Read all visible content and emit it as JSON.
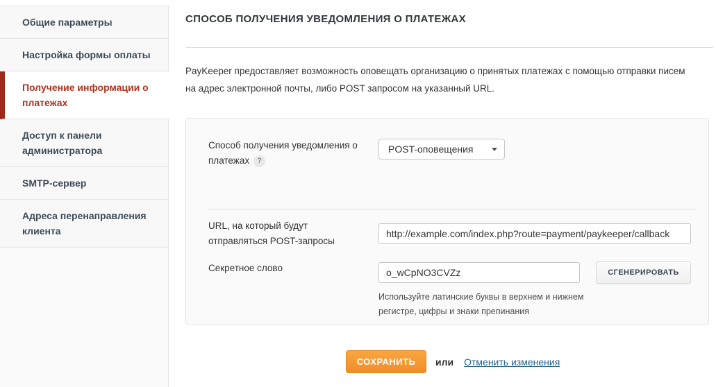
{
  "theme": {
    "save_button_orange": "#f49a33",
    "active_item_red": "#b03221",
    "active_item_border_red": "#9c2b1d",
    "link_blue": "#23628f"
  },
  "sidebar": {
    "items": [
      {
        "label": "Общие параметры",
        "active": false
      },
      {
        "label": "Настройка формы оплаты",
        "active": false
      },
      {
        "label": "Получение информации о платежах",
        "active": true
      },
      {
        "label": "Доступ к панели администратора",
        "active": false
      },
      {
        "label": "SMTP-сервер",
        "active": false
      },
      {
        "label": "Адреса перенаправления клиента",
        "active": false
      }
    ]
  },
  "main": {
    "title": "СПОСОБ ПОЛУЧЕНИЯ УВЕДОМЛЕНИЯ О ПЛАТЕЖАХ",
    "intro_line1": "PayKeeper предоставляет возможность оповещать организацию о принятых платежах с помощью отправки писем",
    "intro_line2": "на адрес электронной почты, либо POST запросом на указанный URL.",
    "form": {
      "notify_method": {
        "label": "Способ получения уведомления о платежах",
        "help_icon": "?",
        "value": "POST-оповещения"
      },
      "post_url": {
        "label": "URL, на который будут отправляться POST-запросы",
        "value": "http://example.com/index.php?route=payment/paykeeper/callback"
      },
      "secret_word": {
        "label": "Секретное слово",
        "value": "o_wCpNO3CVZz",
        "generate_label": "СГЕНЕРИРОВАТЬ",
        "hint": "Используйте латинские буквы в верхнем и нижнем регистре, цифры и знаки препинания"
      }
    },
    "actions": {
      "save_label": "СОХРАНИТЬ",
      "or_label": "или",
      "cancel_label": "Отменить изменения"
    }
  }
}
